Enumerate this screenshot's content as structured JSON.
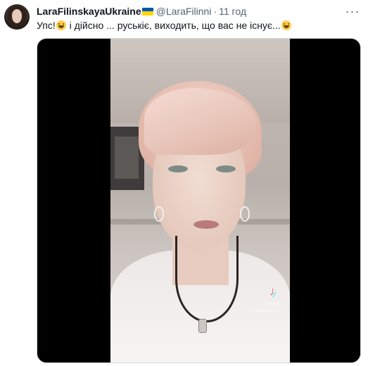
{
  "tweet": {
    "display_name": "LaraFilinskayaUkraine",
    "handle": "@LaraFilinni",
    "separator": "·",
    "time": "11 год",
    "text_part1": "Упс!",
    "text_part2": " і дійсно ... руськіє, виходить, що вас не існує...",
    "more_label": "···"
  },
  "media": {
    "watermark_brand": "TikTok",
    "watermark_user": "@lara_nenov"
  },
  "icons": {
    "flag": "ukraine-flag-icon",
    "emoji": "grinning-face-icon",
    "more": "more-options-icon"
  },
  "colors": {
    "text": "#0f1419",
    "secondary": "#536471",
    "media_bg": "#000000",
    "flag_blue": "#0057b7",
    "flag_yellow": "#ffd700"
  }
}
